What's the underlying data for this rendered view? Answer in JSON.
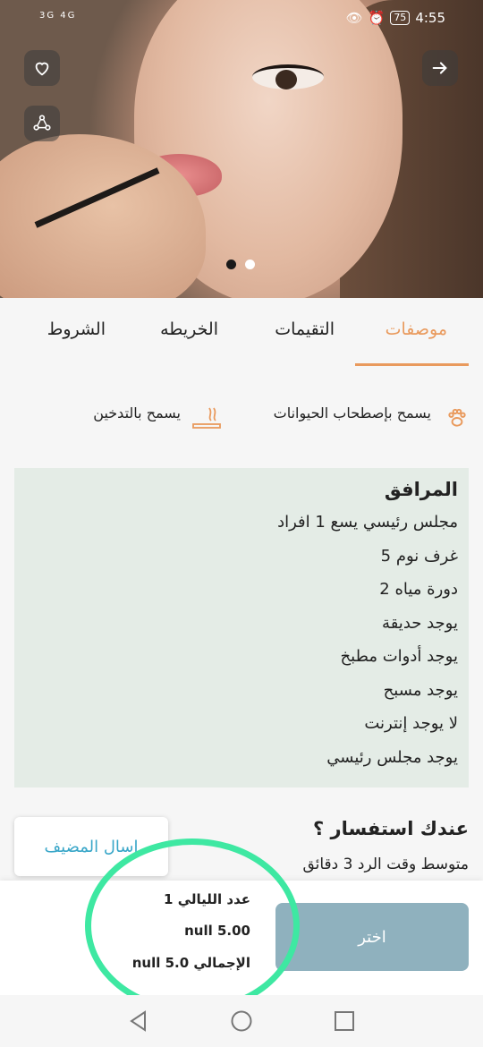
{
  "status_bar": {
    "left_text": "3G 4G",
    "time": "4:55",
    "battery": "75"
  },
  "hero": {
    "slide_count": 2,
    "active_slide": 1
  },
  "tabs": [
    {
      "label": "موصفات",
      "active": true
    },
    {
      "label": "التقيمات",
      "active": false
    },
    {
      "label": "الخريطه",
      "active": false
    },
    {
      "label": "الشروط",
      "active": false
    }
  ],
  "features": {
    "pets": "يسمح بإصطحاب الحيوانات",
    "smoking": "يسمح بالتدخين"
  },
  "amenities": {
    "title": "المرافق",
    "items": [
      "مجلس رئيسي يسع 1 افراد",
      "غرف نوم 5",
      "دورة مياه 2",
      "يوجد حديقة",
      "يوجد أدوات مطبخ",
      "يوجد مسبح",
      "لا يوجد إنترنت",
      "يوجد مجلس رئيسي"
    ]
  },
  "inquiry": {
    "title": "عندك استفسار ؟",
    "response": "متوسط  وقت الرد 3 دقائق",
    "ask_button": "اسال المضيف"
  },
  "booking": {
    "nights": "عدد الليالي    1",
    "price": "null 5.00",
    "total": "الإجمالي null 5.0",
    "choose_button": "اختر"
  },
  "colors": {
    "accent": "#e99a5d",
    "amenities_bg": "#e4ece6",
    "choose_button": "#8fb1be",
    "link": "#38a6c8",
    "annotation": "#3ee8a2"
  }
}
